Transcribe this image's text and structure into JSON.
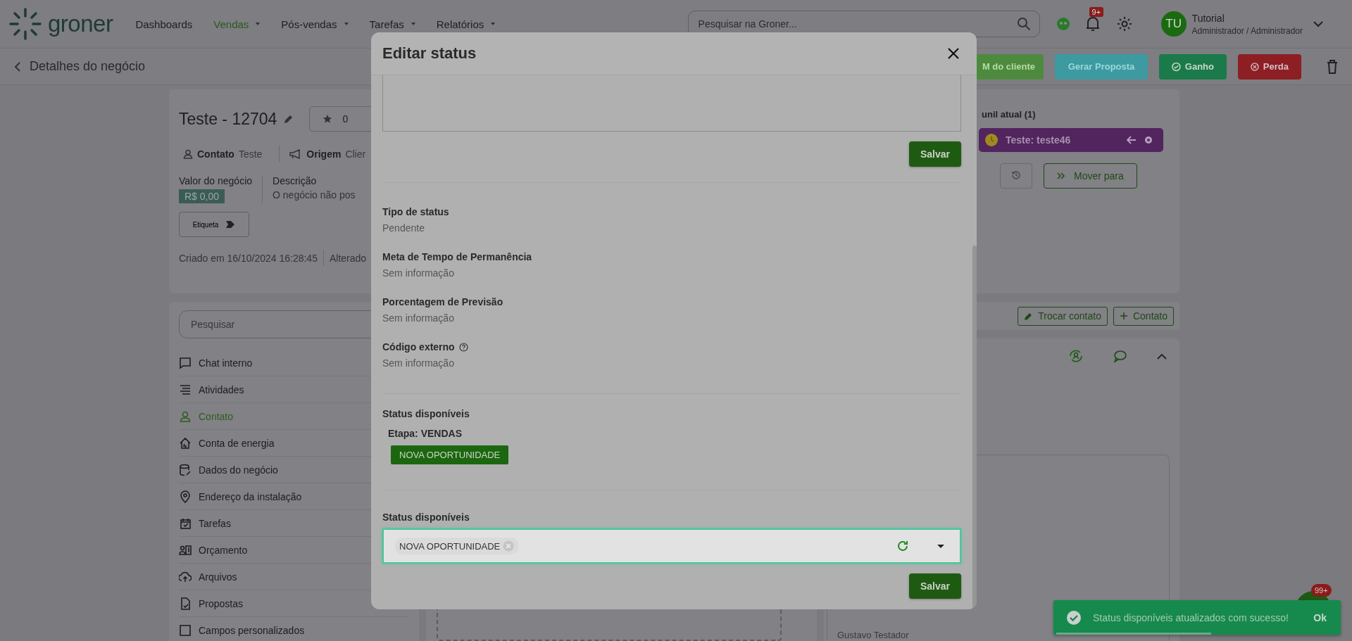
{
  "topbar": {
    "brand": "groner",
    "nav": [
      {
        "label": "Dashboards",
        "selected": false,
        "dropdown": false
      },
      {
        "label": "Vendas",
        "selected": true,
        "dropdown": true
      },
      {
        "label": "Pós-vendas",
        "selected": false,
        "dropdown": true
      },
      {
        "label": "Tarefas",
        "selected": false,
        "dropdown": true
      },
      {
        "label": "Relatórios",
        "selected": false,
        "dropdown": true
      }
    ],
    "search": {
      "placeholder": "Pesquisar na Groner..."
    },
    "notifications_badge": "9+",
    "user": {
      "initials": "TU",
      "name": "Tutorial",
      "role": "Administrador / Administrador"
    }
  },
  "page_header": {
    "title": "Detalhes do negócio",
    "actions": [
      {
        "label": "M do cliente",
        "kind": "client"
      },
      {
        "label": "Gerar Proposta",
        "kind": "proposal"
      },
      {
        "label": "Ganho",
        "kind": "won"
      },
      {
        "label": "Perda",
        "kind": "lost"
      }
    ]
  },
  "deal": {
    "title": "Teste - 12704",
    "rating": "0",
    "contact_label": "Contato",
    "contact_value": "Teste",
    "origin_label": "Origem",
    "origin_value": "Clier",
    "value_label": "Valor do negócio",
    "value": "R$ 0,00",
    "description_label": "Descrição",
    "description": "O negócio não pos",
    "tag_button": "Etiqueta",
    "created": "Criado em 16/10/2024 16:28:45",
    "changed": "Alterado"
  },
  "side_menu": {
    "search_placeholder": "Pesquisar",
    "items": [
      {
        "label": "Chat interno",
        "selected": false
      },
      {
        "label": "Atividades",
        "selected": false
      },
      {
        "label": "Contato",
        "selected": true
      },
      {
        "label": "Conta de energia",
        "selected": false
      },
      {
        "label": "Dados do negócio",
        "selected": false
      },
      {
        "label": "Endereço da instalação",
        "selected": false
      },
      {
        "label": "Tarefas",
        "selected": false
      },
      {
        "label": "Orçamento",
        "selected": false
      },
      {
        "label": "Arquivos",
        "selected": false
      },
      {
        "label": "Propostas",
        "selected": false
      },
      {
        "label": "Campos personalizados",
        "selected": false
      }
    ]
  },
  "funnel": {
    "title": "unil atual (1)",
    "stage": "Teste: teste46",
    "move_button": "Mover para"
  },
  "contact_actions": [
    {
      "label": "Trocar contato",
      "kind": "swap"
    },
    {
      "label": "Contato",
      "kind": "add"
    }
  ],
  "contact_card": {
    "name": "Gustavo Testador"
  },
  "modal": {
    "title": "Editar status",
    "save_top": "Salvar",
    "fields": [
      {
        "label": "Tipo de status",
        "value": "Pendente",
        "help": false
      },
      {
        "label": "Meta de Tempo de Permanência",
        "value": "Sem informação",
        "help": false
      },
      {
        "label": "Porcentagem de Previsão",
        "value": "Sem informação",
        "help": false
      },
      {
        "label": "Código externo",
        "value": "Sem informação",
        "help": true
      }
    ],
    "available": {
      "title": "Status disponíveis",
      "stage": "Etapa: VENDAS",
      "chips": [
        "NOVA OPORTUNIDADE"
      ]
    },
    "select": {
      "label": "Status disponíveis",
      "tags": [
        "NOVA OPORTUNIDADE"
      ]
    },
    "save_bottom": "Salvar"
  },
  "toast": {
    "message": "Status disponíveis atualizados com sucesso!",
    "button": "Ok",
    "level": 0.55
  },
  "chat_badge": "99+"
}
